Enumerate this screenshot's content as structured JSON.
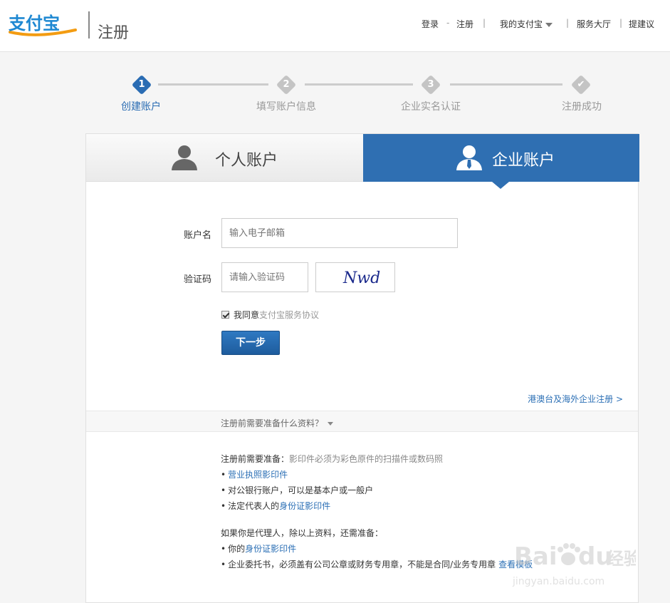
{
  "header": {
    "logo_text": "支付宝",
    "page_title": "注册",
    "nav": {
      "login": "登录",
      "sep1": "-",
      "register": "注册",
      "sep2": "|",
      "my_alipay": "我的支付宝",
      "sep3": "|",
      "service": "服务大厅",
      "sep4": "|",
      "feedback": "提建议"
    }
  },
  "steps": [
    {
      "num": "1",
      "label": "创建账户",
      "active": true
    },
    {
      "num": "2",
      "label": "填写账户信息",
      "active": false
    },
    {
      "num": "3",
      "label": "企业实名认证",
      "active": false
    },
    {
      "num": "✔",
      "label": "注册成功",
      "active": false
    }
  ],
  "tabs": {
    "personal": "个人账户",
    "business": "企业账户"
  },
  "form": {
    "account_label": "账户名",
    "account_placeholder": "输入电子邮箱",
    "captcha_label": "验证码",
    "captcha_placeholder": "请输入验证码",
    "captcha_text": "Nwd",
    "agree_prefix": "我同意",
    "agree_link": "支付宝服务协议",
    "next_button": "下一步",
    "overseas_link": "港澳台及海外企业注册 >"
  },
  "prep": {
    "toggle": "注册前需要准备什么资料？",
    "intro_title": "注册前需要准备：",
    "intro_note": "影印件必须为彩色原件的扫描件或数码照",
    "items": [
      {
        "plain": "",
        "link": "营业执照影印件"
      },
      {
        "plain": "对公银行账户，可以是基本户或一般户",
        "link": ""
      },
      {
        "plain": "法定代表人的",
        "link": "身份证影印件"
      }
    ],
    "agent_title": "如果你是代理人，除以上资料，还需准备：",
    "agent_items": [
      {
        "plain": "你的",
        "link": "身份证影印件"
      },
      {
        "plain": "企业委托书，必须盖有公司公章或财务专用章，不能是合同/业务专用章",
        "link": "查看模板"
      }
    ]
  },
  "watermark": {
    "brand": "Bai",
    "brand2": "du",
    "suffix": "经验",
    "url": "jingyan.baidu.com"
  },
  "colors": {
    "primary": "#2f6fb2",
    "step_active": "#2a6cb3",
    "step_inactive": "#c4c4c4",
    "link": "#2b6fb5",
    "logo_blue": "#1e88d2",
    "logo_orange": "#f39c12"
  }
}
